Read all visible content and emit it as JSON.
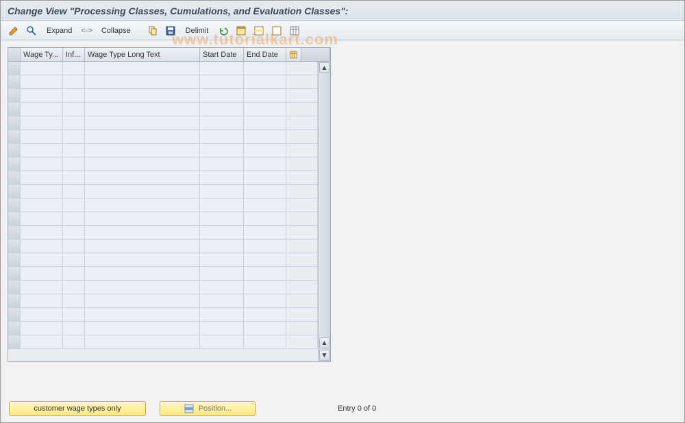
{
  "title": "Change View \"Processing Classes, Cumulations, and Evaluation Classes\":",
  "toolbar": {
    "expand": "Expand",
    "arrows": "<->",
    "collapse": "Collapse",
    "delimit": "Delimit"
  },
  "table": {
    "columns": {
      "wage_type": "Wage Ty...",
      "inf": "Inf...",
      "long_text": "Wage Type Long Text",
      "start_date": "Start Date",
      "end_date": "End Date"
    },
    "row_count": 21
  },
  "footer": {
    "customer_btn": "customer wage types only",
    "position_btn": "Position...",
    "entry": "Entry 0 of 0"
  },
  "watermark": "www.tutorialkart.com"
}
